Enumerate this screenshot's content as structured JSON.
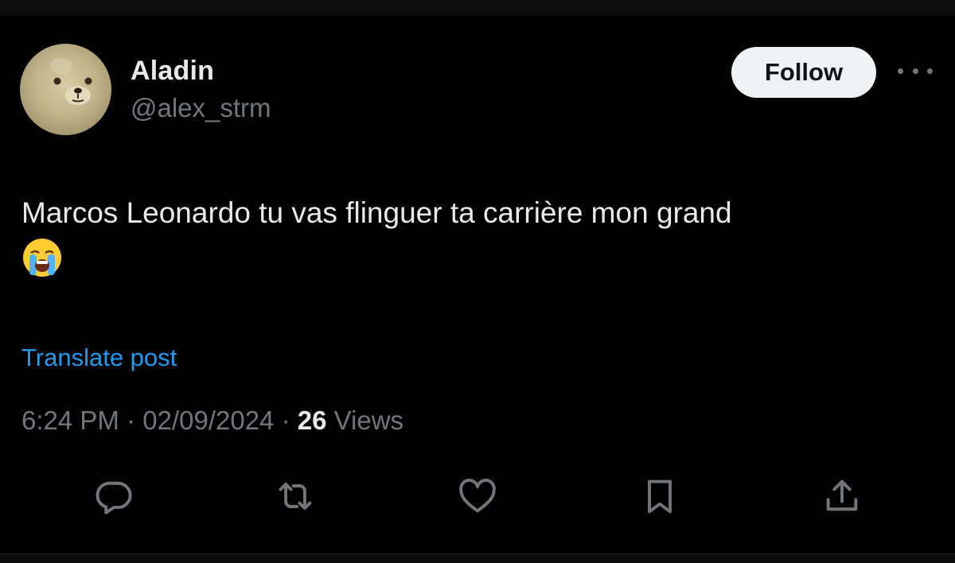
{
  "author": {
    "name": "Aladin",
    "handle": "@alex_strm",
    "avatar_icon": "teddy-bear-avatar"
  },
  "follow_button": {
    "label": "Follow"
  },
  "more_menu": {
    "icon": "more-horizontal-icon"
  },
  "post": {
    "text": "Marcos Leonardo tu vas flinguer ta carrière mon grand",
    "emoji": "loudly-crying-face-emoji"
  },
  "translate_link": "Translate post",
  "meta": {
    "time": "6:24 PM",
    "separator": " · ",
    "date": "02/09/2024",
    "views_count": "26",
    "views_label": "Views"
  },
  "actions": [
    {
      "name": "reply",
      "icon": "reply-icon"
    },
    {
      "name": "repost",
      "icon": "repost-icon"
    },
    {
      "name": "like",
      "icon": "heart-icon"
    },
    {
      "name": "bookmark",
      "icon": "bookmark-icon"
    },
    {
      "name": "share",
      "icon": "share-icon"
    }
  ],
  "colors": {
    "background": "#000000",
    "text_primary": "#e7e9ea",
    "text_secondary": "#71767b",
    "link": "#1d9bf0",
    "follow_bg": "#eff3f4"
  }
}
